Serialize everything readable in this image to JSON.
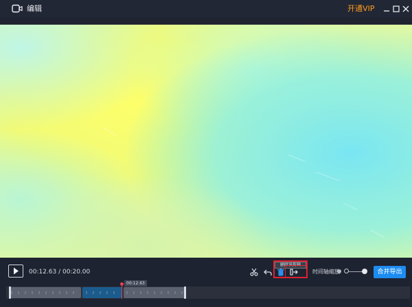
{
  "window": {
    "title": "编辑",
    "vip_label": "开通VIP",
    "controls": [
      "minimize-icon",
      "maximize-icon",
      "close-icon"
    ]
  },
  "preview": {
    "description_colors": [
      "#f4fb66",
      "#b5f5a8",
      "#8ef0e6",
      "#c4f3f6"
    ]
  },
  "player": {
    "time_display": "00:12.63 / 00:20.00"
  },
  "toolbar": {
    "icons": [
      "scissors-icon",
      "undo-icon",
      "delete-icon",
      "split-icon"
    ],
    "tooltip": "删除该剪辑",
    "zoom_label": "时间轴缩放",
    "zoom_level": 0.35,
    "export_label": "合并导出"
  },
  "timeline": {
    "playhead_time": "00:12.63",
    "clips": [
      {
        "name": "clip-1",
        "selected": false
      },
      {
        "name": "clip-2",
        "selected": true
      },
      {
        "name": "clip-3",
        "selected": false
      }
    ]
  },
  "colors": {
    "accent": "#1d8cf0",
    "vip": "#ff9d1e",
    "highlight": "#e02030",
    "playhead": "#e64150"
  }
}
